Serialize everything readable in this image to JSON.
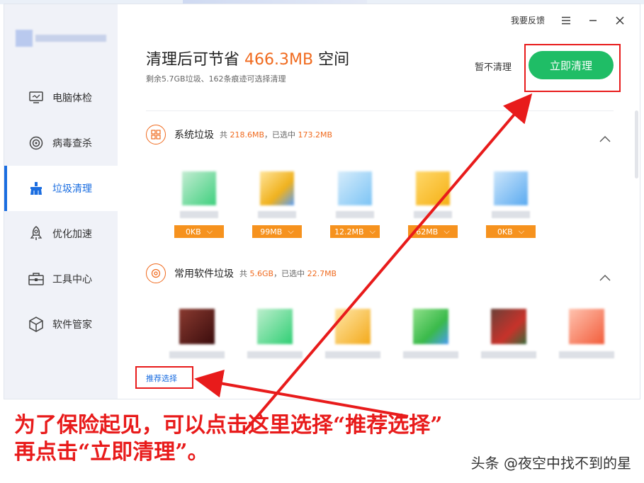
{
  "topbar": {
    "feedback": "我要反馈"
  },
  "sidebar": {
    "items": [
      {
        "label": "电脑体检",
        "icon": "monitor-icon",
        "active": false
      },
      {
        "label": "病毒查杀",
        "icon": "target-icon",
        "active": false
      },
      {
        "label": "垃圾清理",
        "icon": "broom-icon",
        "active": true
      },
      {
        "label": "优化加速",
        "icon": "rocket-icon",
        "active": false
      },
      {
        "label": "工具中心",
        "icon": "toolbox-icon",
        "active": false
      },
      {
        "label": "软件管家",
        "icon": "box-icon",
        "active": false
      }
    ]
  },
  "header": {
    "title_prefix": "清理后可节省",
    "amount": "466.3MB",
    "title_suffix": "空间",
    "subtitle": "剩余5.7GB垃圾、162条痕迹可选择清理",
    "skip_label": "暂不清理",
    "clean_label": "立即清理"
  },
  "sections": [
    {
      "title": "系统垃圾",
      "meta_prefix": "共",
      "total": "218.6MB",
      "meta_mid": "，已选中",
      "selected": "173.2MB",
      "tiles": [
        "0KB",
        "99MB",
        "12.2MB",
        "62MB",
        "0KB"
      ]
    },
    {
      "title": "常用软件垃圾",
      "meta_prefix": "共",
      "total": "5.6GB",
      "meta_mid": "，已选中",
      "selected": "22.7MB"
    }
  ],
  "recommend_label": "推荐选择",
  "caption": {
    "line1": "为了保险起见，可以点击这里选择“推荐选择”",
    "line2": "再点击“立即清理”。"
  },
  "watermark": "头条 @夜空中找不到的星",
  "colors": {
    "accent": "#1a6de0",
    "orange": "#f06a1e",
    "green": "#1fbd66",
    "annotation": "#e81b1b"
  }
}
